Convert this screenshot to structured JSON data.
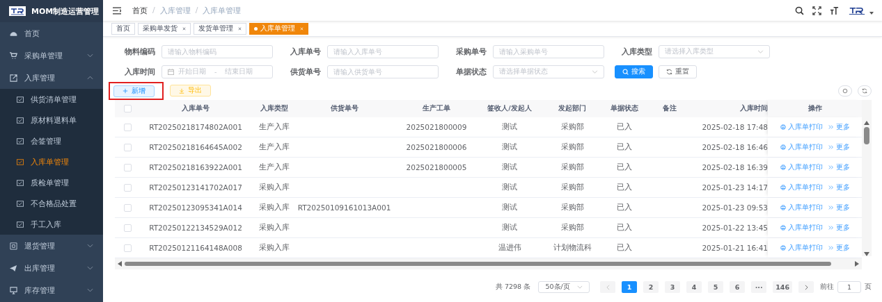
{
  "app": {
    "title": "MOM制造运营管理"
  },
  "sidebar": {
    "items": [
      {
        "label": "首页",
        "selected": false
      },
      {
        "label": "采购单管理",
        "selected": false,
        "expanded": false
      },
      {
        "label": "入库管理",
        "selected": false,
        "expanded": true,
        "children": [
          {
            "label": "供货清单管理",
            "selected": false
          },
          {
            "label": "原材料退料单",
            "selected": false
          },
          {
            "label": "会签管理",
            "selected": false
          },
          {
            "label": "入库单管理",
            "selected": true
          },
          {
            "label": "质检单管理",
            "selected": false
          },
          {
            "label": "不合格品处置",
            "selected": false
          },
          {
            "label": "手工入库",
            "selected": false
          }
        ]
      },
      {
        "label": "退货管理",
        "selected": false,
        "expanded": false
      },
      {
        "label": "出库管理",
        "selected": false,
        "expanded": false
      },
      {
        "label": "库存管理",
        "selected": false,
        "expanded": false
      }
    ]
  },
  "breadcrumb": [
    "首页",
    "入库管理",
    "入库单管理"
  ],
  "breadcrumb_separator": "/",
  "tabs": [
    {
      "label": "首页",
      "selected": false,
      "closable": false
    },
    {
      "label": "采购单发货",
      "selected": false,
      "closable": true
    },
    {
      "label": "发货单管理",
      "selected": false,
      "closable": true
    },
    {
      "label": "入库单管理",
      "selected": true,
      "closable": true
    }
  ],
  "filters": [
    {
      "label": "物料编码",
      "kind": "text",
      "placeholder": "请输入物料编码"
    },
    {
      "label": "入库单号",
      "kind": "text",
      "placeholder": "请输入入库单号"
    },
    {
      "label": "采购单号",
      "kind": "text",
      "placeholder": "请输入采购单号"
    },
    {
      "label": "入库类型",
      "kind": "select",
      "placeholder": "请选择入库类型"
    },
    {
      "label": "入库时间",
      "kind": "daterange",
      "start_placeholder": "开始日期",
      "separator": "-",
      "end_placeholder": "结束日期"
    },
    {
      "label": "供货单号",
      "kind": "text",
      "placeholder": "请输入供货单号"
    },
    {
      "label": "单据状态",
      "kind": "select",
      "placeholder": "请选择单据状态"
    }
  ],
  "filter_buttons": [
    {
      "label": "搜索",
      "kind": "primary"
    },
    {
      "label": "重置",
      "kind": "plain"
    }
  ],
  "toolbar": {
    "buttons": [
      {
        "label": "新增",
        "kind": "add",
        "highlighted": true
      },
      {
        "label": "导出",
        "kind": "export",
        "highlighted": false
      }
    ]
  },
  "table": {
    "all_checked": false,
    "columns": [
      "入库单号",
      "入库类型",
      "供货单号",
      "生产工单",
      "签收人/发起人",
      "发起部门",
      "单据状态",
      "备注",
      "入库时间",
      "操作"
    ],
    "rows": [
      {
        "checked": false,
        "cells": [
          "RT20250218174802A001",
          "生产入库",
          "",
          "2025021800009",
          "测试",
          "采购部",
          "已入",
          "",
          "2025-02-18 17:48"
        ],
        "actions": [
          "入库单打印",
          "更多"
        ]
      },
      {
        "checked": false,
        "cells": [
          "RT20250218164645A002",
          "生产入库",
          "",
          "2025021800006",
          "测试",
          "采购部",
          "已入",
          "",
          "2025-02-18 16:46"
        ],
        "actions": [
          "入库单打印",
          "更多"
        ]
      },
      {
        "checked": false,
        "cells": [
          "RT20250218163922A001",
          "生产入库",
          "",
          "2025021800005",
          "测试",
          "采购部",
          "已入",
          "",
          "2025-02-18 16:39"
        ],
        "actions": [
          "入库单打印",
          "更多"
        ]
      },
      {
        "checked": false,
        "cells": [
          "RT20250123141702A017",
          "采购入库",
          "",
          "",
          "测试",
          "采购部",
          "已入",
          "",
          "2025-01-23 14:17"
        ],
        "actions": [
          "入库单打印",
          "更多"
        ]
      },
      {
        "checked": false,
        "cells": [
          "RT20250123095341A014",
          "采购入库",
          "RT20250109161013A001",
          "",
          "测试",
          "采购部",
          "已入",
          "",
          "2025-01-23 09:53"
        ],
        "actions": [
          "入库单打印",
          "更多"
        ]
      },
      {
        "checked": false,
        "cells": [
          "RT20250122134529A012",
          "采购入库",
          "",
          "",
          "测试",
          "采购部",
          "已入",
          "",
          "2025-01-22 13:45"
        ],
        "actions": [
          "入库单打印",
          "更多"
        ]
      },
      {
        "checked": false,
        "cells": [
          "RT20250121164148A008",
          "采购入库",
          "",
          "",
          "温进伟",
          "计划物流科",
          "已入",
          "",
          "2025-01-21 16:41"
        ],
        "actions": [
          "入库单打印",
          "更多"
        ]
      }
    ]
  },
  "pagination": {
    "total": "共 7298 条",
    "page_size": "50条/页",
    "pages": [
      {
        "label": "1",
        "selected": true
      },
      {
        "label": "2",
        "selected": false
      },
      {
        "label": "3",
        "selected": false
      },
      {
        "label": "4",
        "selected": false
      },
      {
        "label": "5",
        "selected": false
      },
      {
        "label": "6",
        "selected": false
      },
      {
        "label": "···",
        "selected": false
      },
      {
        "label": "146",
        "selected": false
      }
    ],
    "goto_label": "前往",
    "goto_value": "1",
    "goto_suffix": "页"
  }
}
